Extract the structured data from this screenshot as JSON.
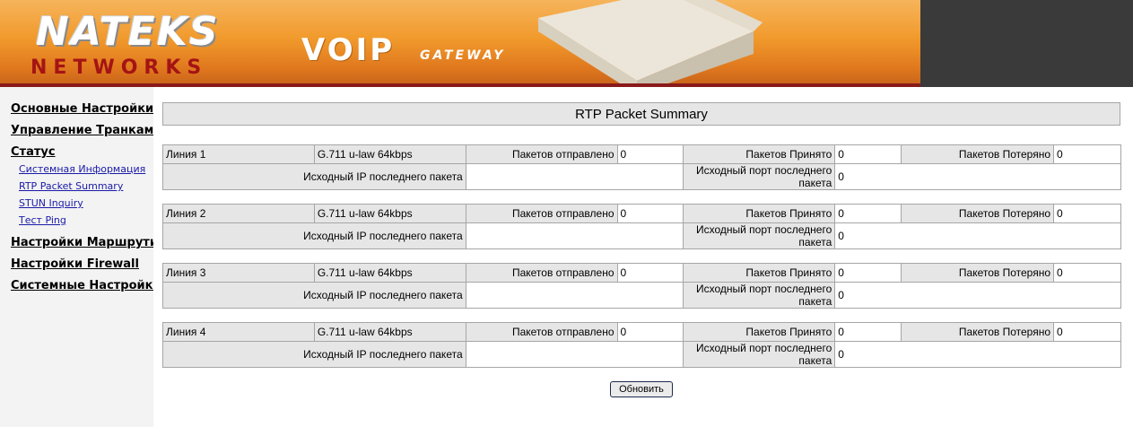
{
  "header": {
    "brand_top": "NATEKS",
    "brand_bottom": "NETWORKS",
    "product": "VOIP",
    "product_sub": "GATEWAY"
  },
  "sidebar": {
    "items": [
      {
        "label": "Основные Настройки"
      },
      {
        "label": "Управление Транками"
      },
      {
        "label": "Статус"
      },
      {
        "label": "Настройки Маршрутизации"
      },
      {
        "label": "Настройки Firewall"
      },
      {
        "label": "Системные Настройки"
      }
    ],
    "status_children": [
      {
        "label": "Системная Информация"
      },
      {
        "label": "RTP Packet Summary"
      },
      {
        "label": "STUN Inquiry"
      },
      {
        "label": "Тест Ping"
      }
    ]
  },
  "main": {
    "title": "RTP Packet Summary",
    "labels": {
      "sent": "Пакетов отправлено",
      "received": "Пакетов Принято",
      "lost": "Пакетов Потеряно",
      "src_ip": "Исходный IP последнего пакета",
      "src_port": "Исходный порт последнего пакета"
    },
    "lines": [
      {
        "name": "Линия 1",
        "codec": "G.711 u-law 64kbps",
        "sent": "0",
        "received": "0",
        "lost": "0",
        "src_ip": "",
        "src_port": "0"
      },
      {
        "name": "Линия 2",
        "codec": "G.711 u-law 64kbps",
        "sent": "0",
        "received": "0",
        "lost": "0",
        "src_ip": "",
        "src_port": "0"
      },
      {
        "name": "Линия 3",
        "codec": "G.711 u-law 64kbps",
        "sent": "0",
        "received": "0",
        "lost": "0",
        "src_ip": "",
        "src_port": "0"
      },
      {
        "name": "Линия 4",
        "codec": "G.711 u-law 64kbps",
        "sent": "0",
        "received": "0",
        "lost": "0",
        "src_ip": "",
        "src_port": "0"
      }
    ],
    "refresh_label": "Обновить"
  }
}
